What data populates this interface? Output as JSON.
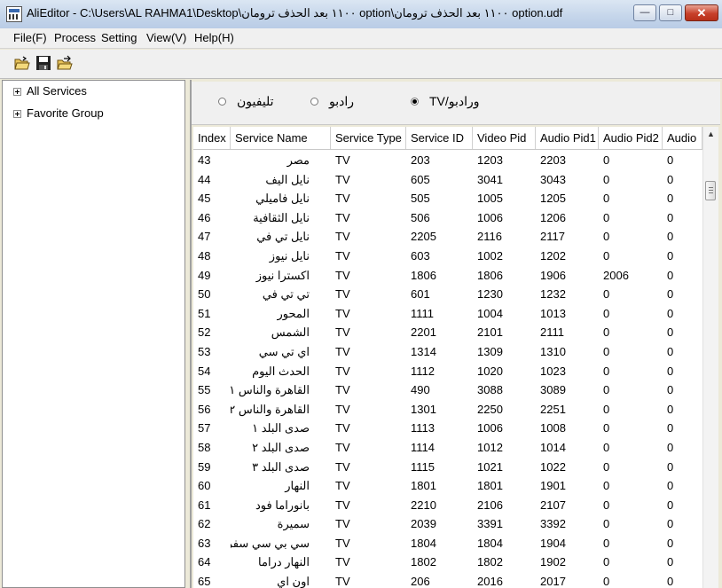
{
  "window": {
    "title": "AliEditor - C:\\Users\\AL RAHMA1\\Desktop\\١١٠٠ بعد الحذف ترومان option\\١١٠٠ بعد الحذف ترومان option.udf"
  },
  "menu": [
    "File(F)",
    "Process",
    "Setting",
    "View(V)",
    "Help(H)"
  ],
  "toolbar": {
    "icons": [
      "open-folder-icon",
      "save-disk-icon",
      "open-file-icon"
    ]
  },
  "tree": [
    "All Services",
    "Favorite Group"
  ],
  "radios": {
    "tv_radio": "TV/ورادبو",
    "radio": "رادبو",
    "telephone": "تليفيون",
    "selected": "tv_radio"
  },
  "table": {
    "columns": [
      "Index",
      "Service Name",
      "Service Type",
      "Service ID",
      "Video Pid",
      "Audio Pid1",
      "Audio Pid2",
      "Audio"
    ],
    "rows": [
      [
        "43",
        "مصر",
        "TV",
        "203",
        "1203",
        "2203",
        "0",
        "0"
      ],
      [
        "44",
        "نايل اليف",
        "TV",
        "605",
        "3041",
        "3043",
        "0",
        "0"
      ],
      [
        "45",
        "نايل فاميلي",
        "TV",
        "505",
        "1005",
        "1205",
        "0",
        "0"
      ],
      [
        "46",
        "نايل الثقافية",
        "TV",
        "506",
        "1006",
        "1206",
        "0",
        "0"
      ],
      [
        "47",
        "نايل تي في",
        "TV",
        "2205",
        "2116",
        "2117",
        "0",
        "0"
      ],
      [
        "48",
        "نايل نيوز",
        "TV",
        "603",
        "1002",
        "1202",
        "0",
        "0"
      ],
      [
        "49",
        "اكسترا نيوز",
        "TV",
        "1806",
        "1806",
        "1906",
        "2006",
        "0"
      ],
      [
        "50",
        "تي تي في",
        "TV",
        "601",
        "1230",
        "1232",
        "0",
        "0"
      ],
      [
        "51",
        "المحور",
        "TV",
        "1111",
        "1004",
        "1013",
        "0",
        "0"
      ],
      [
        "52",
        "الشمس",
        "TV",
        "2201",
        "2101",
        "2111",
        "0",
        "0"
      ],
      [
        "53",
        "اي تي سي",
        "TV",
        "1314",
        "1309",
        "1310",
        "0",
        "0"
      ],
      [
        "54",
        "الحدث اليوم",
        "TV",
        "1112",
        "1020",
        "1023",
        "0",
        "0"
      ],
      [
        "55",
        "القاهرة والناس ١",
        "TV",
        "490",
        "3088",
        "3089",
        "0",
        "0"
      ],
      [
        "56",
        "القاهرة والناس ٢",
        "TV",
        "1301",
        "2250",
        "2251",
        "0",
        "0"
      ],
      [
        "57",
        "صدى البلد ١",
        "TV",
        "1113",
        "1006",
        "1008",
        "0",
        "0"
      ],
      [
        "58",
        "صدى البلد ٢",
        "TV",
        "1114",
        "1012",
        "1014",
        "0",
        "0"
      ],
      [
        "59",
        "صدى البلد ٣",
        "TV",
        "1115",
        "1021",
        "1022",
        "0",
        "0"
      ],
      [
        "60",
        "النهار",
        "TV",
        "1801",
        "1801",
        "1901",
        "0",
        "0"
      ],
      [
        "61",
        "بانوراما فود",
        "TV",
        "2210",
        "2106",
        "2107",
        "0",
        "0"
      ],
      [
        "62",
        "سميرة",
        "TV",
        "2039",
        "3391",
        "3392",
        "0",
        "0"
      ],
      [
        "63",
        "سي بي سي سفرة",
        "TV",
        "1804",
        "1804",
        "1904",
        "0",
        "0"
      ],
      [
        "64",
        "النهار دراما",
        "TV",
        "1802",
        "1802",
        "1902",
        "0",
        "0"
      ],
      [
        "65",
        "اون اي",
        "TV",
        "206",
        "2016",
        "2017",
        "0",
        "0"
      ]
    ]
  }
}
